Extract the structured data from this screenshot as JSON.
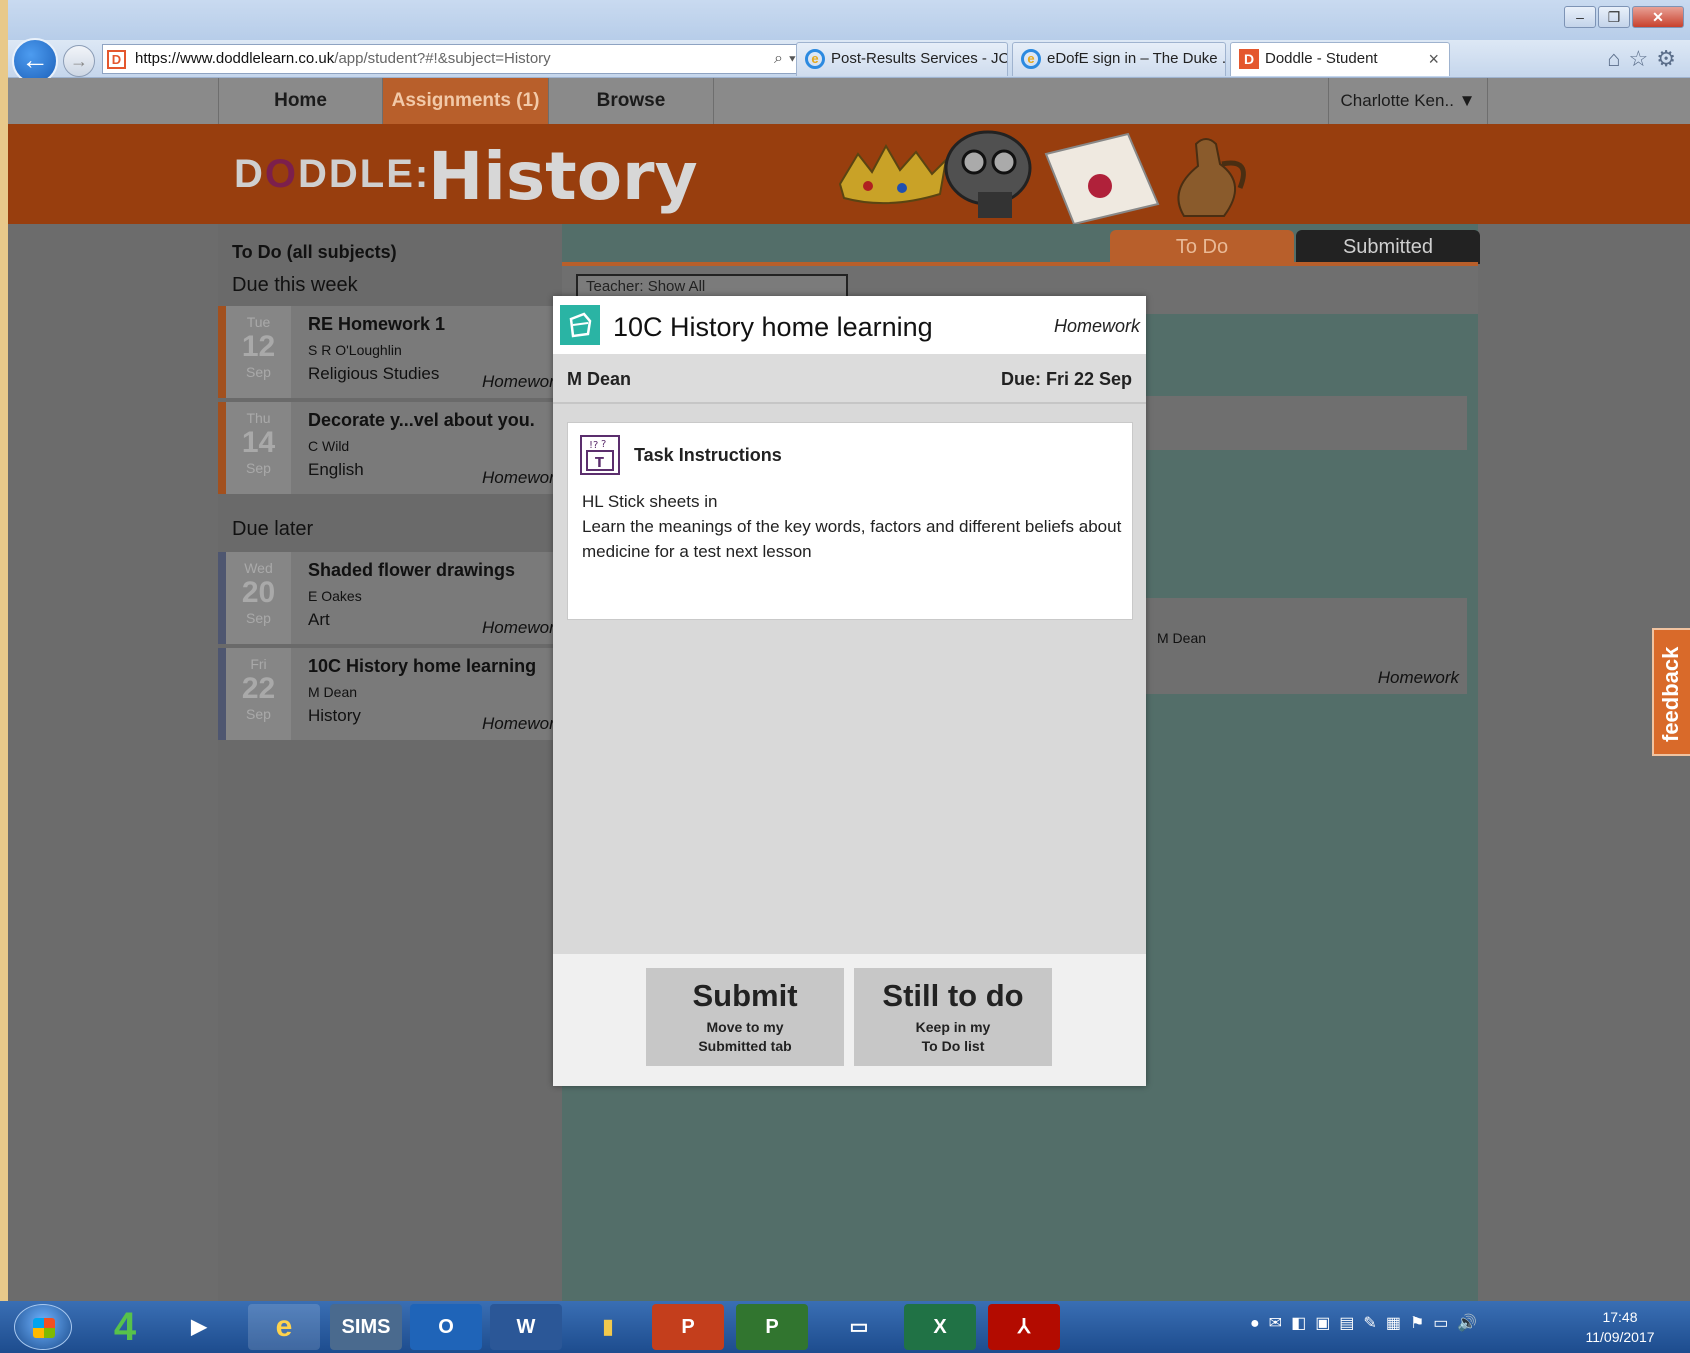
{
  "browser": {
    "url_domain": "https://www.doddlelearn.co.uk",
    "url_path": "/app/student?#!&subject=History",
    "tabs": [
      {
        "label": "Post-Results Services - JC...",
        "active": false
      },
      {
        "label": "eDofE sign in – The Duke ...",
        "active": false
      },
      {
        "label": "Doddle - Student",
        "active": true
      }
    ]
  },
  "nav": {
    "home": "Home",
    "assignments": "Assignments (1)",
    "browse": "Browse",
    "user": "Charlotte Ken.. ▼"
  },
  "banner": {
    "logo": "DODDLE:",
    "subject": "History"
  },
  "sidebar": {
    "heading": "To Do (all subjects)",
    "group_this_week": "Due this week",
    "group_later": "Due later",
    "tasks": [
      {
        "dow": "Tue",
        "day": "12",
        "mon": "Sep",
        "title": "RE Homework 1",
        "teacher": "S R O'Loughlin",
        "subject": "Religious Studies",
        "kind": "Homework"
      },
      {
        "dow": "Thu",
        "day": "14",
        "mon": "Sep",
        "title": "Decorate y...vel about you.",
        "teacher": "C Wild",
        "subject": "English",
        "kind": "Homework"
      },
      {
        "dow": "Wed",
        "day": "20",
        "mon": "Sep",
        "title": "Shaded flower drawings",
        "teacher": "E Oakes",
        "subject": "Art",
        "kind": "Homework"
      },
      {
        "dow": "Fri",
        "day": "22",
        "mon": "Sep",
        "title": "10C History home learning",
        "teacher": "M Dean",
        "subject": "History",
        "kind": "Homework"
      }
    ]
  },
  "main": {
    "tab_todo": "To Do",
    "tab_submitted": "Submitted",
    "teacher_filter": "Teacher:  Show All",
    "card_teacher": "M Dean",
    "card_kind": "Homework"
  },
  "modal": {
    "title": "10C History home learning",
    "kind": "Homework",
    "teacher": "M Dean",
    "due": "Due: Fri 22 Sep",
    "instructions_title": "Task Instructions",
    "instructions_line1": "HL Stick sheets in",
    "instructions_line2": "Learn the meanings of the key words, factors and different beliefs about medicine for a test next lesson",
    "submit_label": "Submit",
    "submit_sub1": "Move to my",
    "submit_sub2": "Submitted tab",
    "still_label": "Still to do",
    "still_sub1": "Keep in my",
    "still_sub2": "To Do list"
  },
  "feedback": "feedback",
  "taskbar": {
    "sims": "SIMS",
    "time": "17:48",
    "date": "11/09/2017"
  },
  "colors": {
    "doddle_orange": "#b85f2b",
    "banner": "#983e0e",
    "teal": "#536e69"
  }
}
